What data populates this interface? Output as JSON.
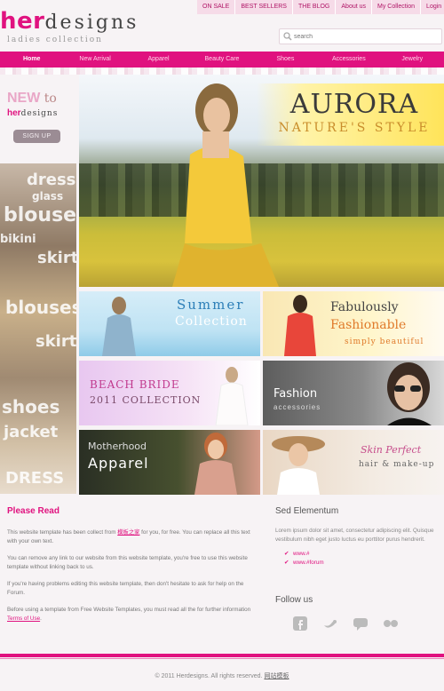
{
  "brand": {
    "her": "her",
    "designs": "designs",
    "tagline": "ladies collection"
  },
  "topnav": [
    "ON SALE",
    "BEST SELLERS",
    "THE BLOG",
    "About us",
    "My Collection",
    "Login"
  ],
  "search": {
    "placeholder": "search"
  },
  "mainnav": [
    "Home",
    "New Arrival",
    "Apparel",
    "Beauty Care",
    "Shoes",
    "Accessories",
    "Jewelry"
  ],
  "sidebar": {
    "new": "NEW",
    "to": "to",
    "brand_her": "her",
    "brand_designs": "designs",
    "signup": "SIGN UP",
    "collage_words": [
      "dress",
      "glass",
      "blouses",
      "bikini",
      "skirt",
      "shoes",
      "jacket",
      "DRESS"
    ]
  },
  "hero": {
    "title": "AURORA",
    "subtitle": "NATURE'S STYLE"
  },
  "tiles": {
    "summer": {
      "line1": "Summer",
      "line2": "Collection"
    },
    "fabulous": {
      "line1": "Fabulously",
      "line2": "Fashionable",
      "line3": "simply beautiful"
    },
    "beach": {
      "line1": "BEACH BRIDE",
      "line2": "2011 COLLECTION"
    },
    "fashion": {
      "line1": "Fashion",
      "line2": "accessories"
    },
    "motherhood": {
      "line1": "Motherhood",
      "line2": "Apparel"
    },
    "skin": {
      "line1": "Skin Perfect",
      "line2": "hair & make-up"
    }
  },
  "read": {
    "title": "Please Read",
    "p1_a": "This website template has been collect from ",
    "p1_link": "模板之家",
    "p1_b": " for you, for free. You can replace all this text with your own text.",
    "p2": "You can remove any link to our website from this website template, you're free to use this website template without linking back to us.",
    "p3": "If you're having problems editing this website template, then don't hesitate to ask for help on the Forum.",
    "p4_a": "Before using a template from Free Website Templates, you must read all the for further information ",
    "p4_link": "Terms of Use",
    "p4_b": "."
  },
  "sed": {
    "title": "Sed Elementum",
    "text": "Lorem ipsum dolor sit amet, consectetur adipiscing elit. Quisque vestibulum nibh eget justo luctus eu porttitor purus hendrerit.",
    "links": [
      "www.#",
      "www.#forum"
    ]
  },
  "follow": {
    "title": "Follow us",
    "icons": [
      "facebook-icon",
      "twitter-icon",
      "chat-icon",
      "flickr-icon"
    ]
  },
  "footer": {
    "copyright": "© 2011 Herdesigns. All rights reserved.",
    "link": "网站模板"
  },
  "colors": {
    "accent": "#e0127f"
  }
}
